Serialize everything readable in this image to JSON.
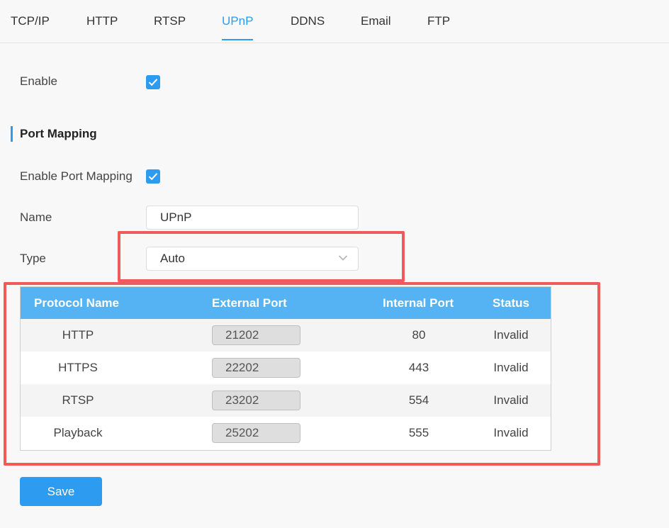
{
  "tabs": [
    {
      "label": "TCP/IP",
      "active": false
    },
    {
      "label": "HTTP",
      "active": false
    },
    {
      "label": "RTSP",
      "active": false
    },
    {
      "label": "UPnP",
      "active": true
    },
    {
      "label": "DDNS",
      "active": false
    },
    {
      "label": "Email",
      "active": false
    },
    {
      "label": "FTP",
      "active": false
    }
  ],
  "enable": {
    "label": "Enable",
    "checked": true
  },
  "port_mapping": {
    "title": "Port Mapping",
    "enable_label": "Enable Port Mapping",
    "enable_checked": true,
    "name_label": "Name",
    "name_value": "UPnP",
    "type_label": "Type",
    "type_value": "Auto",
    "type_icon": "chevron-down-icon"
  },
  "table": {
    "headers": [
      "Protocol Name",
      "External Port",
      "Internal Port",
      "Status"
    ],
    "rows": [
      {
        "protocol": "HTTP",
        "external": "21202",
        "internal": "80",
        "status": "Invalid"
      },
      {
        "protocol": "HTTPS",
        "external": "22202",
        "internal": "443",
        "status": "Invalid"
      },
      {
        "protocol": "RTSP",
        "external": "23202",
        "internal": "554",
        "status": "Invalid"
      },
      {
        "protocol": "Playback",
        "external": "25202",
        "internal": "555",
        "status": "Invalid"
      }
    ]
  },
  "save_label": "Save",
  "colors": {
    "accent": "#2d9cf0",
    "table_header": "#55b3f3",
    "highlight": "#f05a5a"
  }
}
